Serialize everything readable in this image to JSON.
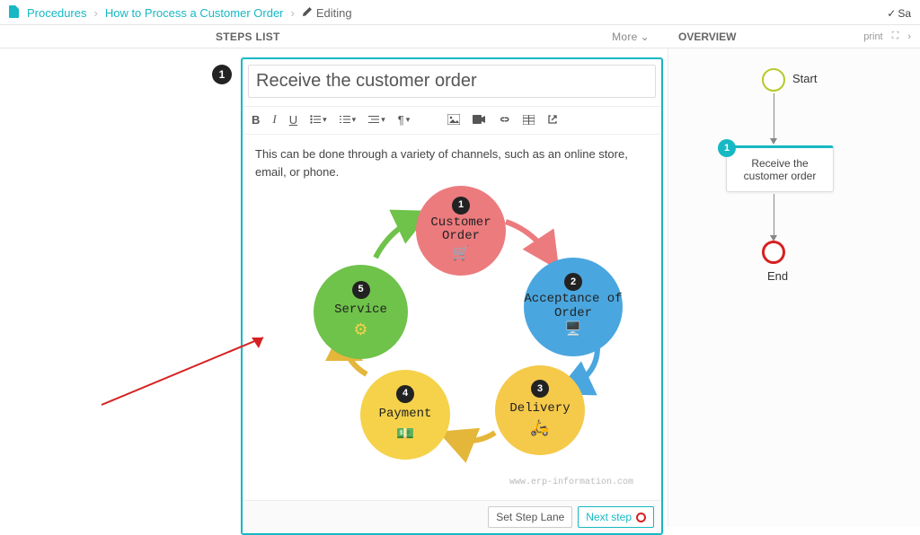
{
  "breadcrumb": {
    "root": "Procedures",
    "page": "How to Process a Customer Order",
    "state": "Editing"
  },
  "top_right": "Sa",
  "headers": {
    "steps": "STEPS LIST",
    "more": "More",
    "overview": "OVERVIEW",
    "print": "print"
  },
  "step_badge": "1",
  "editor": {
    "title": "Receive the customer order",
    "body": "This can be done through a variety of channels, such as an online store, email, or phone.",
    "toolbar": {
      "bold": "B",
      "italic": "I",
      "underline": "U",
      "bullets_icon": "bullets",
      "numbers_icon": "numbers",
      "indent_icon": "indent",
      "align_icon": "paragraph",
      "image_icon": "image",
      "video_icon": "video",
      "link_icon": "link",
      "table_icon": "table",
      "open_icon": "open-external"
    },
    "cycle": {
      "nodes": [
        {
          "n": "1",
          "label": "Customer Order",
          "icon": "cart"
        },
        {
          "n": "2",
          "label": "Acceptance of  Order",
          "icon": "webapp"
        },
        {
          "n": "3",
          "label": "Delivery",
          "icon": "courier"
        },
        {
          "n": "4",
          "label": "Payment",
          "icon": "money"
        },
        {
          "n": "5",
          "label": "Service",
          "icon": "gear"
        }
      ],
      "watermark": "www.erp-information.com"
    },
    "actions": {
      "set_lane": "Set Step Lane",
      "next": "Next step"
    }
  },
  "overview": {
    "start": "Start",
    "step": {
      "n": "1",
      "label": "Receive the customer order"
    },
    "end": "End"
  }
}
